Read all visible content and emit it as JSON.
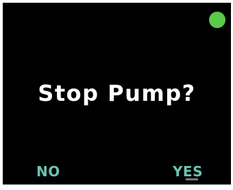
{
  "dialog": {
    "prompt": "Stop Pump?",
    "no_label": "NO",
    "yes_label": "YES"
  },
  "status": {
    "icon": "status-indicator-dot",
    "color": "#5cc84a"
  },
  "colors": {
    "background": "#000000",
    "prompt_text": "#ffffff",
    "action_text": "#6cc3b0"
  }
}
